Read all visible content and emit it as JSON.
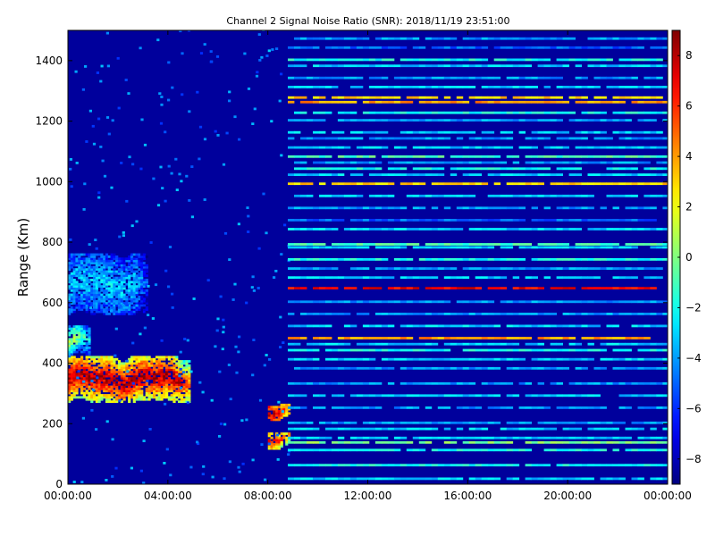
{
  "chart_data": {
    "type": "heatmap",
    "title": "Channel 2 Signal Noise Ratio (SNR): 2018/11/19 23:51:00",
    "xlabel": "",
    "ylabel": "Range (Km)",
    "x_range_hours": [
      0,
      24
    ],
    "y_range_km": [
      0,
      1500
    ],
    "x_ticks": [
      {
        "hours": 0,
        "label": "00:00:00"
      },
      {
        "hours": 4,
        "label": "04:00:00"
      },
      {
        "hours": 8,
        "label": "08:00:00"
      },
      {
        "hours": 12,
        "label": "12:00:00"
      },
      {
        "hours": 16,
        "label": "16:00:00"
      },
      {
        "hours": 20,
        "label": "20:00:00"
      },
      {
        "hours": 24,
        "label": "00:00:00"
      }
    ],
    "y_ticks": [
      0,
      200,
      400,
      600,
      800,
      1000,
      1200,
      1400
    ],
    "colorbar": {
      "range": [
        -9,
        9
      ],
      "ticks": [
        8,
        6,
        4,
        2,
        0,
        -2,
        -4,
        -6,
        -8
      ],
      "colormap": "jet"
    },
    "background_value": -8.5,
    "blobs": [
      {
        "name": "main-echo",
        "t_start": 0,
        "t_end": 4.8,
        "r_min": 270,
        "r_max": 420,
        "core": 8.5,
        "edge": 1
      },
      {
        "name": "upper-echo",
        "t_start": 0,
        "t_end": 3.2,
        "r_min": 560,
        "r_max": 760,
        "core": -3,
        "edge": -6
      },
      {
        "name": "mid-echo",
        "t_start": 0,
        "t_end": 0.8,
        "r_min": 420,
        "r_max": 520,
        "core": 1,
        "edge": -4
      },
      {
        "name": "late-echo-upper",
        "t_start": 8.0,
        "t_end": 8.8,
        "r_min": 210,
        "r_max": 260,
        "core": 8,
        "edge": 5
      },
      {
        "name": "late-echo-lower",
        "t_start": 8.0,
        "t_end": 8.8,
        "r_min": 115,
        "r_max": 170,
        "core": 7,
        "edge": 2
      }
    ],
    "noise_start_hours": 8.8,
    "noise_bands_km": [
      {
        "r": 1470,
        "v": -4
      },
      {
        "r": 1440,
        "v": -5
      },
      {
        "r": 1400,
        "v": -2
      },
      {
        "r": 1380,
        "v": -3
      },
      {
        "r": 1340,
        "v": -4
      },
      {
        "r": 1310,
        "v": -3
      },
      {
        "r": 1275,
        "v": 3
      },
      {
        "r": 1260,
        "v": 4
      },
      {
        "r": 1225,
        "v": -2
      },
      {
        "r": 1200,
        "v": -4
      },
      {
        "r": 1160,
        "v": -3
      },
      {
        "r": 1140,
        "v": -4
      },
      {
        "r": 1110,
        "v": -3
      },
      {
        "r": 1080,
        "v": -1
      },
      {
        "r": 1060,
        "v": -4
      },
      {
        "r": 1040,
        "v": -2
      },
      {
        "r": 1020,
        "v": -3
      },
      {
        "r": 990,
        "v": 3
      },
      {
        "r": 950,
        "v": -3
      },
      {
        "r": 910,
        "v": -4
      },
      {
        "r": 870,
        "v": -5
      },
      {
        "r": 840,
        "v": -3
      },
      {
        "r": 790,
        "v": -1
      },
      {
        "r": 780,
        "v": -3
      },
      {
        "r": 740,
        "v": -2
      },
      {
        "r": 710,
        "v": -4
      },
      {
        "r": 680,
        "v": -3
      },
      {
        "r": 645,
        "v": 7
      },
      {
        "r": 600,
        "v": -4
      },
      {
        "r": 560,
        "v": -4
      },
      {
        "r": 520,
        "v": -3
      },
      {
        "r": 480,
        "v": 4
      },
      {
        "r": 460,
        "v": -3
      },
      {
        "r": 440,
        "v": -2
      },
      {
        "r": 410,
        "v": -3
      },
      {
        "r": 380,
        "v": -4
      },
      {
        "r": 330,
        "v": -4
      },
      {
        "r": 290,
        "v": -3
      },
      {
        "r": 250,
        "v": -4
      },
      {
        "r": 200,
        "v": -4
      },
      {
        "r": 180,
        "v": -3
      },
      {
        "r": 150,
        "v": -3
      },
      {
        "r": 135,
        "v": 0
      },
      {
        "r": 110,
        "v": -2
      },
      {
        "r": 60,
        "v": -2
      },
      {
        "r": 15,
        "v": -3
      }
    ]
  }
}
